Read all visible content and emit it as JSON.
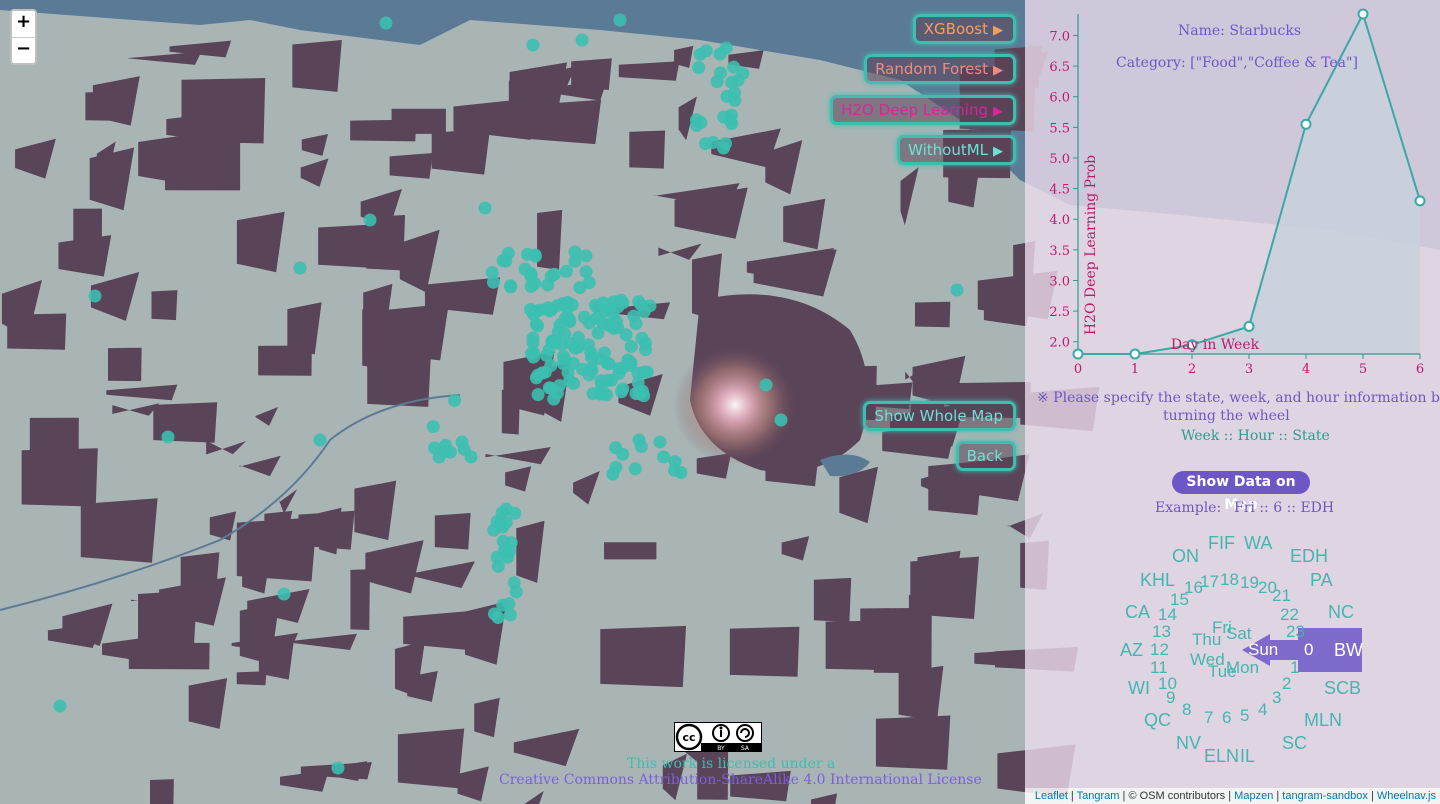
{
  "map": {
    "zoom_in": "+",
    "zoom_out": "−",
    "land_color": "#a9b5b5",
    "block_color": "#5a4458",
    "water_color": "#5b7a96",
    "point_color": "#3bbfb0",
    "heat_color": "#f5c6c6"
  },
  "model_buttons": [
    {
      "label": "XGBoost",
      "color": "#f5a05c",
      "arrow": "▶"
    },
    {
      "label": "Random Forest",
      "color": "#f08a80",
      "arrow": "▶"
    },
    {
      "label": "H2O Deep Learning",
      "color": "#d6269b",
      "arrow": "▶"
    },
    {
      "label": "WithoutML",
      "color": "#6ee0d4",
      "arrow": "▶"
    }
  ],
  "show_whole_map": "Show Whole Map",
  "back": "Back",
  "panel": {
    "name": "Name: Starbucks",
    "category": "Category: [\"Food\",\"Coffee & Tea\"]",
    "note": "※ Please specify the state, week, and hour information by",
    "note2": "turning the wheel",
    "wheel_format": "Week :: Hour :: State",
    "show_data_button": "Show Data on Map",
    "example_label": "Example:",
    "example_value": "Fri :: 6 :: EDH"
  },
  "chart_data": {
    "type": "line",
    "x": [
      0,
      1,
      2,
      3,
      4,
      5,
      6
    ],
    "y": [
      1.8,
      1.8,
      1.95,
      2.25,
      5.55,
      7.35,
      4.3
    ],
    "xlabel": "Day in Week",
    "ylabel": "H2O Deep Learning Prob",
    "xticks": [
      "0",
      "1",
      "2",
      "3",
      "4",
      "5",
      "6"
    ],
    "yticks": [
      "2.0",
      "2.5",
      "3.0",
      "3.5",
      "4.0",
      "4.5",
      "5.0",
      "5.5",
      "6.0",
      "6.5",
      "7.0"
    ],
    "xlim": [
      0,
      6
    ],
    "ylim": [
      1.8,
      7.35
    ],
    "line_color": "#3aa9a5",
    "fill_color": "#c8d0dc",
    "axis_color": "#2a9d8f",
    "tick_color": "#c0186b"
  },
  "wheel": {
    "states": [
      "ON",
      "FIF",
      "WA",
      "EDH",
      "KHL",
      "PA",
      "CA",
      "NC",
      "AZ",
      "BW",
      "WI",
      "SCB",
      "QC",
      "MLN",
      "NV",
      "ELN",
      "IL",
      "SC"
    ],
    "hours": [
      "17",
      "18",
      "19",
      "20",
      "16",
      "15",
      "21",
      "14",
      "22",
      "13",
      "23",
      "12",
      "0",
      "11",
      "1",
      "10",
      "2",
      "9",
      "3",
      "8",
      "4",
      "7",
      "5",
      "6"
    ],
    "days": [
      "Fri",
      "Sat",
      "Thu",
      "Sun",
      "Wed",
      "Mon",
      "Tue"
    ],
    "selected_state": "BW",
    "selected_hour": "0",
    "selected_day": "Sun",
    "pointer_color": "#6d57c7"
  },
  "license": {
    "line1": "This work is licensed under a",
    "line2": "Creative Commons Attribution-ShareAlike 4.0 International License",
    "badge_by": "BY",
    "badge_sa": "SA"
  },
  "attribution": {
    "leaflet": "Leaflet",
    "tangram": "Tangram",
    "osm": "© OSM contributors",
    "mapzen": "Mapzen",
    "sandbox": "tangram-sandbox",
    "wheelnav": "Wheelnav.js"
  }
}
